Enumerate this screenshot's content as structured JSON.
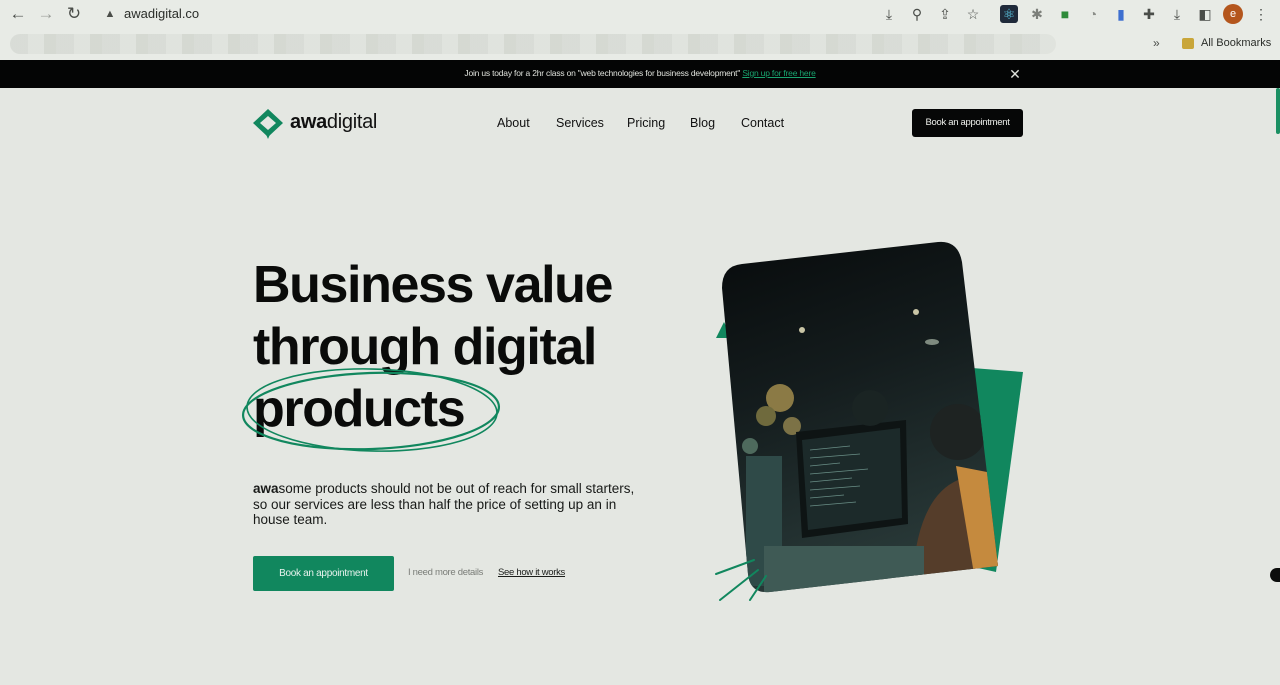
{
  "browser": {
    "url": "awadigital.co",
    "profile_initial": "e",
    "bookmarks_label": "All Bookmarks",
    "bookmarks_overflow": "»"
  },
  "announcement": {
    "text": "Join us today for a 2hr class on \"web technologies for business development\" ",
    "link": "Sign up for free here",
    "close": "✕"
  },
  "header": {
    "logo": {
      "bold": "awa",
      "rest": "digital"
    },
    "nav": [
      "About",
      "Services",
      "Pricing",
      "Blog",
      "Contact"
    ],
    "cta": "Book an appointment"
  },
  "hero": {
    "title_lines": [
      "Business value",
      "through digital",
      "products"
    ],
    "description_bold": "awa",
    "description_rest": "some products should not be out of reach for small starters, so our services are less than half the price of setting up an in house team.",
    "cta": "Book an appointment",
    "more_label": "I need more details",
    "more_link": "See how it works"
  },
  "colors": {
    "brand_green": "#11875e",
    "announcement_bg": "#040505",
    "page_bg": "#e4e7e2"
  }
}
